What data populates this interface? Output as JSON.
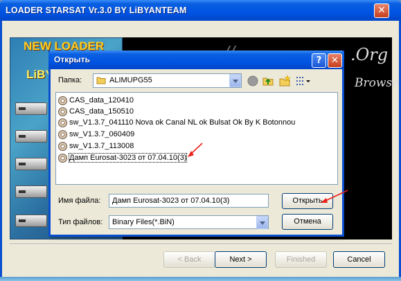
{
  "window": {
    "title": "LOADER STARSAT  Vr.3.0 BY LiBYANTEAM",
    "close_glyph": "✕"
  },
  "banner": {
    "new_loader": "NEW LOADER",
    "liby": "LiBY",
    "url_fragment": "://",
    "org": ".Org",
    "browse": "Browse"
  },
  "wizard_buttons": {
    "back": "< Back",
    "next": "Next >",
    "finished": "Finished",
    "cancel": "Cancel"
  },
  "dialog": {
    "title": "Открыть",
    "help_glyph": "?",
    "close_glyph": "✕",
    "folder_label": "Папка:",
    "folder_value": "ALIMUPG55",
    "files": [
      {
        "name": "CAS_data_120410"
      },
      {
        "name": "CAS_data_150510"
      },
      {
        "name": "sw_V1.3.7_041110 Nova ok Canal NL ok Bulsat Ok By K Botonnou"
      },
      {
        "name": "sw_V1.3.7_060409"
      },
      {
        "name": "sw_V1.3.7_113008"
      },
      {
        "name": "Дамп Eurosat-3023  от 07.04.10(3)"
      }
    ],
    "selected_file_index": 5,
    "filename_label": "Имя файла:",
    "filename_value": "Дамп Eurosat-3023  от 07.04.10(3)",
    "filetype_label": "Тип файлов:",
    "filetype_value": "Binary Files(*.BiN)",
    "open_button": "Открыть",
    "cancel_button": "Отмена"
  },
  "colors": {
    "titlebar_blue": "#0054e3",
    "dialog_face": "#ece9d8",
    "annotation_arrow": "#e8201a"
  },
  "icons": [
    "folder-icon",
    "back-icon",
    "up-folder-icon",
    "new-folder-icon",
    "view-menu-icon",
    "disk-file-icon",
    "help-icon",
    "close-icon"
  ]
}
